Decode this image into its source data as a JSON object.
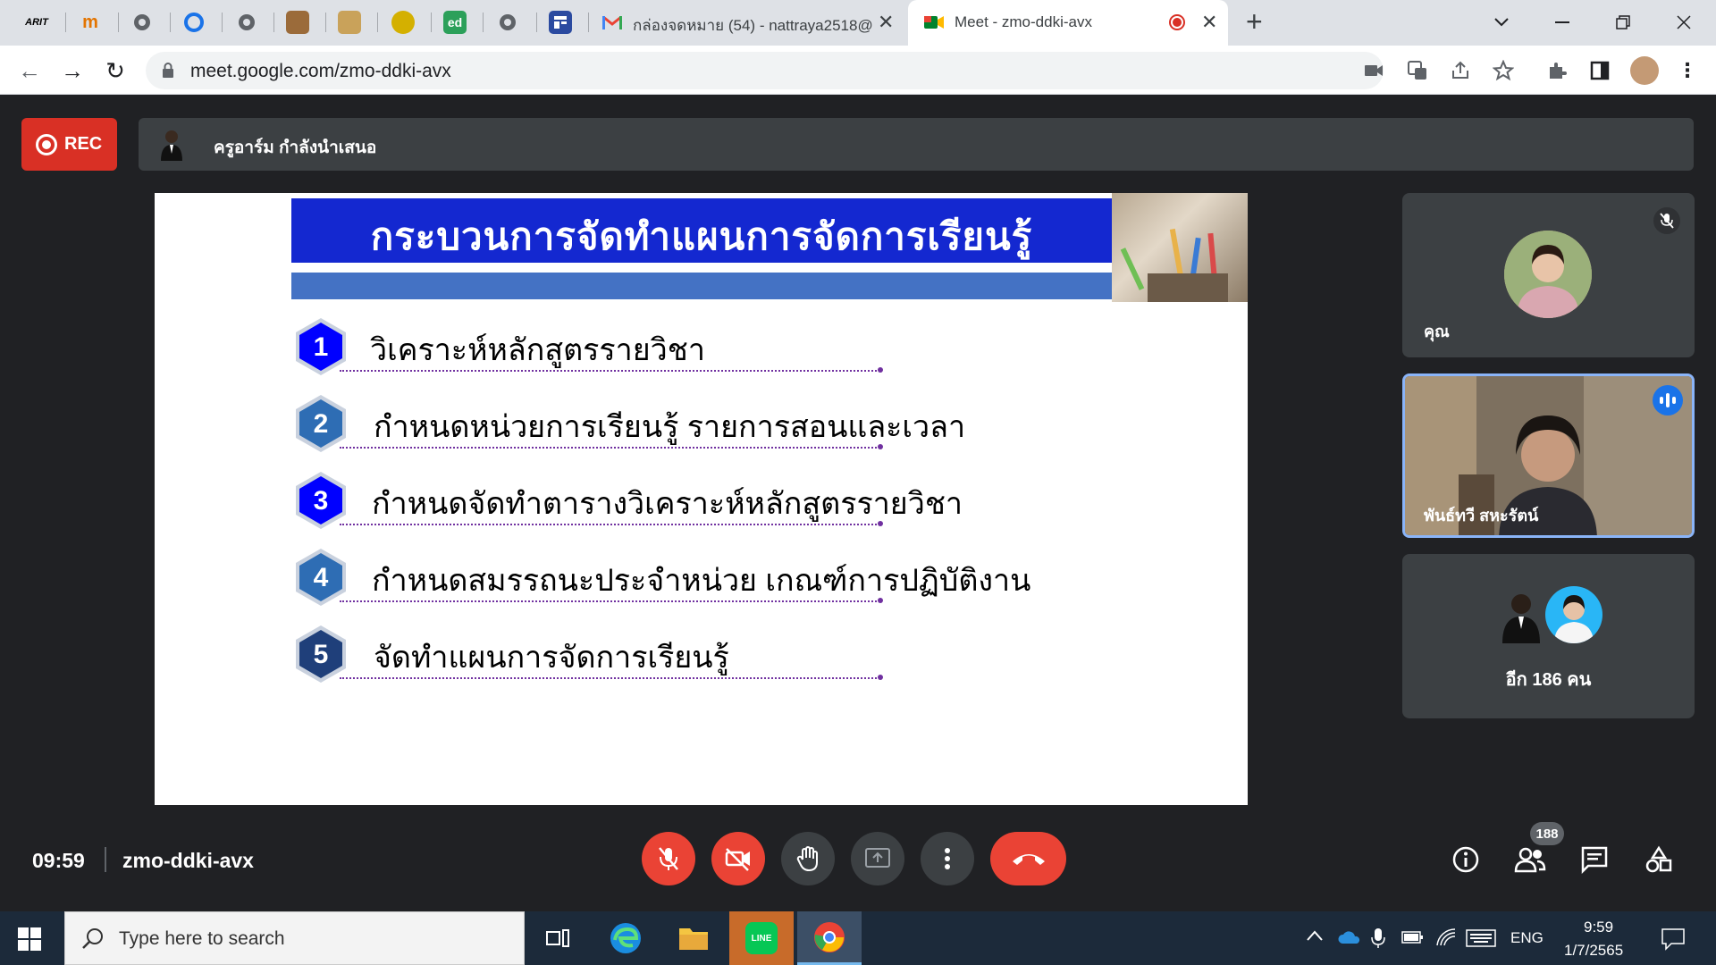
{
  "browser": {
    "tabs": [
      {
        "label": "กล่องจดหมาย (54) - nattraya2518@",
        "icon": "gmail-icon"
      },
      {
        "label": "Meet - zmo-ddki-avx",
        "icon": "meet-icon",
        "active": true
      }
    ],
    "pinned_tabs": [
      "ARIT",
      "m",
      "globe",
      "O",
      "globe",
      "person",
      "person",
      "seal",
      "ed",
      "globe",
      "form"
    ],
    "url": "meet.google.com/zmo-ddki-avx"
  },
  "meet": {
    "rec_label": "REC",
    "presenter_text": "ครูอาร์ม กำลังนำเสนอ",
    "slide": {
      "title": "กระบวนการจัดทำแผนการจัดการเรียนรู้",
      "steps": [
        {
          "number": "1",
          "text": "วิเคราะห์หลักสูตรรายวิชา",
          "color": "#0000ff"
        },
        {
          "number": "2",
          "text": "กำหนดหน่วยการเรียนรู้ รายการสอนและเวลา",
          "color": "#2e6db4"
        },
        {
          "number": "3",
          "text": "กำหนดจัดทำตารางวิเคราะห์หลักสูตรรายวิชา",
          "color": "#0000ff"
        },
        {
          "number": "4",
          "text": "กำหนดสมรรถนะประจำหน่วย เกณฑ์การปฏิบัติงาน",
          "color": "#2e6db4"
        },
        {
          "number": "5",
          "text": "จัดทำแผนการจัดการเรียนรู้",
          "color": "#1f3f7a"
        }
      ]
    },
    "participants": {
      "self_label": "คุณ",
      "active_speaker": "พันธ์ทวี สหะรัตน์",
      "others_label": "อีก 186 คน"
    },
    "meeting_time": "09:59",
    "meeting_code": "zmo-ddki-avx",
    "people_count": "188"
  },
  "taskbar": {
    "search_placeholder": "Type here to search",
    "lang": "ENG",
    "clock_time": "9:59",
    "clock_date": "1/7/2565"
  }
}
